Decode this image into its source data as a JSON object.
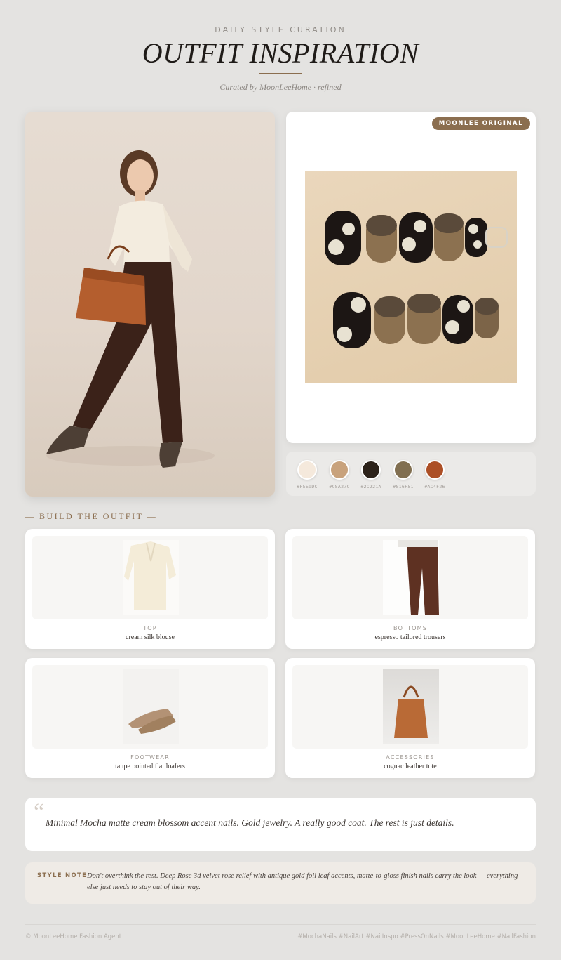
{
  "header": {
    "eyebrow": "DAILY STYLE CURATION",
    "title": "OUTFIT INSPIRATION",
    "subtitle": "Curated by MoonLeeHome · refined"
  },
  "nails": {
    "badge": "MOONLEE ORIGINAL"
  },
  "palette": [
    {
      "hex": "#F5E9DC",
      "color": "#F5E9DC"
    },
    {
      "hex": "#C8A27C",
      "color": "#C8A27C"
    },
    {
      "hex": "#2C221A",
      "color": "#2C221A"
    },
    {
      "hex": "#816F51",
      "color": "#816F51"
    },
    {
      "hex": "#AC4F26",
      "color": "#AC4F26"
    }
  ],
  "build": {
    "label": "— BUILD THE OUTFIT —",
    "items": [
      {
        "category": "TOP",
        "description": "cream silk blouse"
      },
      {
        "category": "BOTTOMS",
        "description": "espresso tailored trousers"
      },
      {
        "category": "FOOTWEAR",
        "description": "taupe pointed flat loafers"
      },
      {
        "category": "ACCESSORIES",
        "description": "cognac leather tote"
      }
    ]
  },
  "quote": {
    "mark": "“",
    "text": "Minimal Mocha matte cream blossom accent nails. Gold jewelry. A really good coat. The rest is just details."
  },
  "style_note": {
    "label": "STYLE NOTE",
    "text": "Don't overthink the rest. Deep Rose 3d velvet rose relief with antique gold foil leaf accents, matte-to-gloss finish nails carry the look — everything else just needs to stay out of their way."
  },
  "footer": {
    "left": "© MoonLeeHome Fashion Agent",
    "right": "#MochaNails #NailArt #NailInspo #PressOnNails #MoonLeeHome #NailFashion"
  }
}
